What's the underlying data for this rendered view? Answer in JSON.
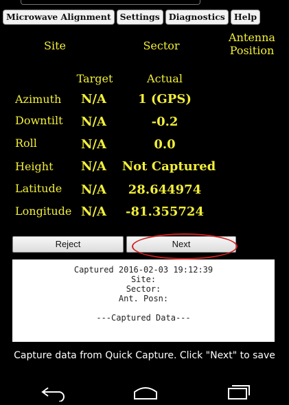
{
  "tabs": [
    "Microwave Alignment",
    "Settings",
    "Diagnostics",
    "Help"
  ],
  "header": {
    "site": "Site",
    "sector": "Sector",
    "antenna_position": "Antenna Position"
  },
  "columns": {
    "target": "Target",
    "actual": "Actual"
  },
  "rows": [
    {
      "label": "Azimuth",
      "target": "N/A",
      "actual": "1 (GPS)"
    },
    {
      "label": "Downtilt",
      "target": "N/A",
      "actual": "-0.2"
    },
    {
      "label": "Roll",
      "target": "N/A",
      "actual": "0.0"
    },
    {
      "label": "Height",
      "target": "N/A",
      "actual": "Not Captured"
    },
    {
      "label": "Latitude",
      "target": "N/A",
      "actual": "28.644974"
    },
    {
      "label": "Longitude",
      "target": "N/A",
      "actual": "-81.355724"
    }
  ],
  "buttons": {
    "reject": "Reject",
    "next": "Next"
  },
  "log": {
    "line1": "Captured 2016-02-03 19:12:39",
    "line2": "Site:",
    "line3": "Sector:",
    "line4": "Ant. Posn:",
    "line5": "",
    "line6": "---Captured Data---"
  },
  "hint": "Capture data from Quick Capture. Click \"Next\" to save",
  "colors": {
    "text_yellow": "#f2ee3a",
    "background": "#000000",
    "highlight_circle": "#d21f1f"
  },
  "icons": {
    "back": "back-icon",
    "home": "home-icon",
    "recents": "recents-icon"
  }
}
